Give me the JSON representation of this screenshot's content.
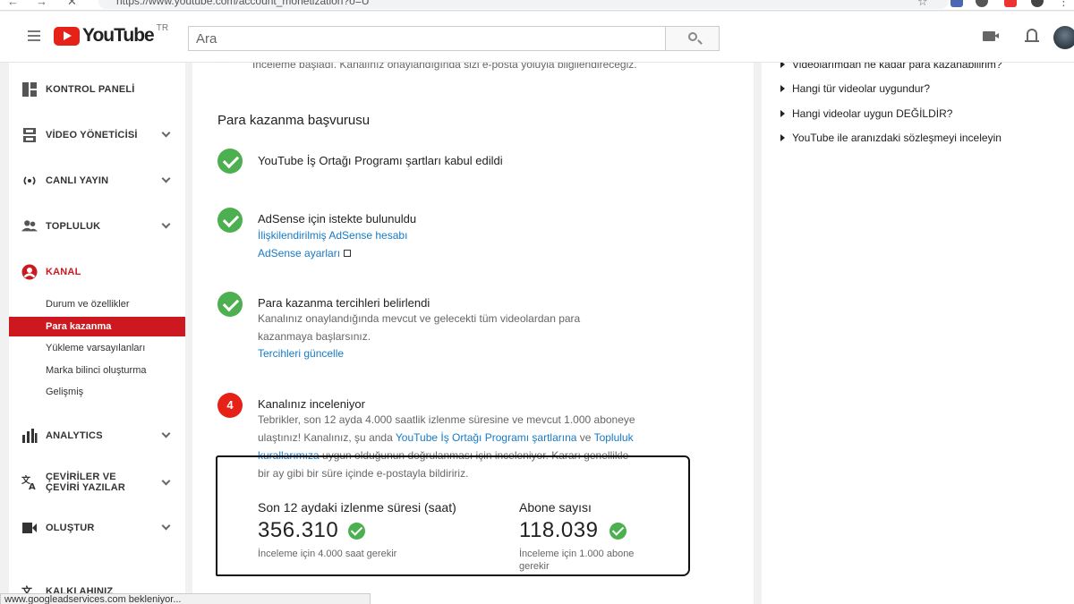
{
  "browser": {
    "url": "https://www.youtube.com/account_monetization?o=U"
  },
  "header": {
    "logo_text": "YouTube",
    "logo_region": "TR",
    "search_placeholder": "Ara"
  },
  "sidebar": {
    "items": [
      {
        "label": "KONTROL PANELİ",
        "icon": "dashboard-icon"
      },
      {
        "label": "VİDEO YÖNETİCİSİ",
        "icon": "video-manager-icon"
      },
      {
        "label": "CANLI YAYIN",
        "icon": "live-icon"
      },
      {
        "label": "TOPLULUK",
        "icon": "community-icon"
      },
      {
        "label": "KANAL",
        "icon": "channel-icon"
      },
      {
        "label": "ANALYTICS",
        "icon": "analytics-icon"
      },
      {
        "label": "ÇEVİRİLER VE ÇEVİRİ YAZILAR",
        "icon": "translate-icon"
      },
      {
        "label": "OLUŞTUR",
        "icon": "create-icon"
      },
      {
        "label": "KALKI AHINIZ",
        "icon": "other-icon"
      }
    ],
    "channel_sub": [
      {
        "label": "Durum ve özellikler"
      },
      {
        "label": "Para kazanma"
      },
      {
        "label": "Yükleme varsayılanları"
      },
      {
        "label": "Marka bilinci oluşturma"
      },
      {
        "label": "Gelişmiş"
      }
    ]
  },
  "main": {
    "top_text": "İnceleme başladı. Kanalınız onaylandığında sizi e-posta yoluyla bilgilendireceğiz.",
    "section_title": "Para kazanma başvurusu",
    "steps": [
      {
        "title": "YouTube İş Ortağı Programı şartları kabul edildi"
      },
      {
        "title": "AdSense için istekte bulunuldu",
        "link1": "İlişkilendirilmiş AdSense hesabı",
        "link2": "AdSense ayarları"
      },
      {
        "title": "Para kazanma tercihleri belirlendi",
        "text": "Kanalınız onaylandığında mevcut ve gelecekti tüm videolardan para kazanmaya başlarsınız.",
        "link": "Tercihleri güncelle"
      },
      {
        "number": "4",
        "title": "Kanalınız inceleniyor",
        "text_a": "Tebrikler, son 12 ayda 4.000 saatlik izlenme süresine ve mevcut 1.000 aboneye ulaştınız! Kanalınız, şu anda ",
        "link_a": "YouTube İş Ortağı Programı şartlarına",
        "text_b": " ve ",
        "link_b": "Topluluk kurallarımıza",
        "text_c": " uygun olduğunun doğrulanması için inceleniyor. Kararı genellikle bir ay gibi bir süre içinde e-postayla bildiririz."
      }
    ],
    "stats": {
      "watch_label": "Son 12 aydaki izlenme süresi (saat)",
      "watch_value": "356.310",
      "watch_note": "İnceleme için 4.000 saat gerekir",
      "subs_label": "Abone sayısı",
      "subs_value": "118.039",
      "subs_note": "İnceleme için 1.000 abone gerekir"
    }
  },
  "help": {
    "items": [
      "Videolarımdan ne kadar para kazanabilirim?",
      "Hangi tür videolar uygundur?",
      "Hangi videolar uygun DEĞİLDİR?",
      "YouTube ile aranızdaki sözleşmeyi inceleyin"
    ]
  },
  "status_bar": "www.googleadservices.com bekleniyor..."
}
